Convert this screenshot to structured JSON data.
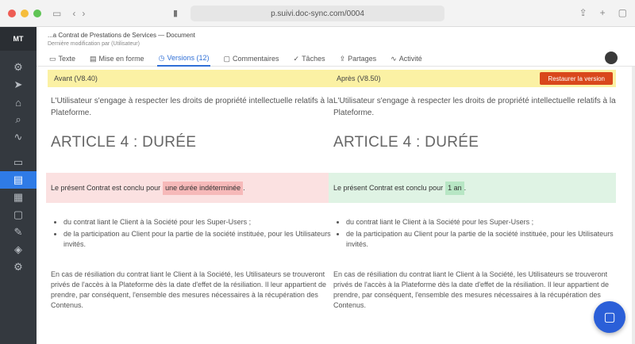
{
  "browser": {
    "url": "p.suivi.doc-sync.com/0004"
  },
  "sidebar": {
    "top_label": "MT",
    "items": [
      {
        "icon": "gear-icon",
        "glyph": "⚙"
      },
      {
        "icon": "send-icon",
        "glyph": "➤"
      },
      {
        "icon": "bank-icon",
        "glyph": "⌂"
      },
      {
        "icon": "search-icon",
        "glyph": "⌕"
      },
      {
        "icon": "activity-icon",
        "glyph": "∿"
      },
      {
        "icon": "folder-icon",
        "glyph": "▭"
      },
      {
        "icon": "document-icon",
        "glyph": "▤",
        "active": true
      },
      {
        "icon": "calendar-icon",
        "glyph": "▦"
      },
      {
        "icon": "chat-icon",
        "glyph": "▢"
      },
      {
        "icon": "pencil-icon",
        "glyph": "✎"
      },
      {
        "icon": "shield-icon",
        "glyph": "◈"
      },
      {
        "icon": "settings-icon",
        "glyph": "⚙"
      }
    ]
  },
  "header": {
    "breadcrumb": "...a Contrat de Prestations de Services — Document",
    "sub_breadcrumb": "Dernière modification par (Utilisateur)",
    "tabs": [
      {
        "label": "Texte",
        "icon": "text-icon",
        "glyph": "▭"
      },
      {
        "label": "Mise en forme",
        "icon": "format-icon",
        "glyph": "▤"
      },
      {
        "label": "Versions (12)",
        "icon": "versions-icon",
        "glyph": "◷",
        "active": true
      },
      {
        "label": "Commentaires",
        "icon": "comment-icon",
        "glyph": "▢"
      },
      {
        "label": "Tâches",
        "icon": "task-icon",
        "glyph": "✓"
      },
      {
        "label": "Partages",
        "icon": "share-icon",
        "glyph": "⇪"
      },
      {
        "label": "Activité",
        "icon": "history-icon",
        "glyph": "∿"
      }
    ]
  },
  "compare": {
    "before_label": "Avant (V8.40)",
    "after_label": "Après (V8.50)",
    "restore_label": "Restaurer la version",
    "intro_left": "L'Utilisateur s'engage à respecter les droits de propriété intellectuelle relatifs à la Plateforme.",
    "intro_right": "L'Utilisateur s'engage à respecter les droits de propriété intellectuelle relatifs à la Plateforme.",
    "article_title": "ARTICLE 4 : DURÉE",
    "removed_text": "Le présent Contrat est conclu pour",
    "removed_highlight": "une durée indéterminée",
    "added_text": "Le présent Contrat est conclu pour",
    "added_highlight": "1 an",
    "bullets_left": [
      "du contrat liant le Client à la Société pour les Super-Users ;",
      "de la participation au Client pour la partie de la société instituée, pour les Utilisateurs invités."
    ],
    "bullets_right": [
      "du contrat liant le Client à la Société pour les Super-Users ;",
      "de la participation au Client pour la partie de la société instituée, pour les Utilisateurs invités."
    ],
    "bottom_left": "En cas de résiliation du contrat liant le Client à la Société, les Utilisateurs se trouveront privés de l'accès à la Plateforme dès la date d'effet de la résiliation. Il leur appartient de prendre, par conséquent, l'ensemble des mesures nécessaires à la récupération des Contenus.",
    "bottom_right": "En cas de résiliation du contrat liant le Client à la Société, les Utilisateurs se trouveront privés de l'accès à la Plateforme dès la date d'effet de la résiliation. Il leur appartient de prendre, par conséquent, l'ensemble des mesures nécessaires à la récupération des Contenus."
  },
  "colors": {
    "accent": "#2f6fd6",
    "restore": "#d9481c",
    "removed_bg": "#fbe1e1",
    "added_bg": "#dff3e4",
    "version_bar": "#fbf1a4"
  }
}
